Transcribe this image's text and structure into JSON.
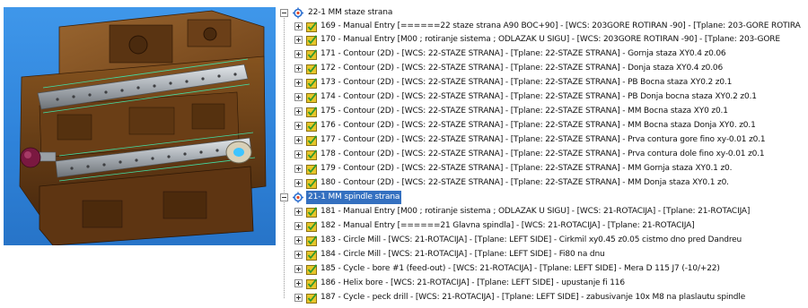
{
  "tree": {
    "groups": [
      {
        "label": "22-1 MM staze strana",
        "selected": false,
        "items": [
          {
            "text": "169 - Manual Entry [======22 staze strana A90 BOC+90] - [WCS: 203GORE ROTIRAN -90] - [Tplane: 203-GORE ROTIRA"
          },
          {
            "text": "170 - Manual Entry [M00 ; rotiranje sistema ; ODLAZAK U SIGU] - [WCS: 203GORE ROTIRAN -90] - [Tplane: 203-GORE"
          },
          {
            "text": "171 - Contour (2D) - [WCS: 22-STAZE STRANA] - [Tplane: 22-STAZE STRANA] - Gornja staza XY0.4 z0.06"
          },
          {
            "text": "172 - Contour (2D) - [WCS: 22-STAZE STRANA] - [Tplane: 22-STAZE STRANA] - Donja staza XY0.4 z0.06"
          },
          {
            "text": "173 - Contour (2D) - [WCS: 22-STAZE STRANA] - [Tplane: 22-STAZE STRANA] - PB Bocna staza XY0.2 z0.1"
          },
          {
            "text": "174 - Contour (2D) - [WCS: 22-STAZE STRANA] - [Tplane: 22-STAZE STRANA] - PB Donja bocna staza XY0.2 z0.1"
          },
          {
            "text": "175 - Contour (2D) - [WCS: 22-STAZE STRANA] - [Tplane: 22-STAZE STRANA] - MM Bocna staza XY0 z0.1"
          },
          {
            "text": "176 - Contour (2D) - [WCS: 22-STAZE STRANA] - [Tplane: 22-STAZE STRANA] - MM Bocna staza Donja XY0. z0.1"
          },
          {
            "text": "177 - Contour (2D) - [WCS: 22-STAZE STRANA] - [Tplane: 22-STAZE STRANA] - Prva contura gore fino xy-0.01 z0.1"
          },
          {
            "text": "178 - Contour (2D) - [WCS: 22-STAZE STRANA] - [Tplane: 22-STAZE STRANA] - Prva contura dole fino xy-0.01 z0.1"
          },
          {
            "text": "179 - Contour (2D) - [WCS: 22-STAZE STRANA] - [Tplane: 22-STAZE STRANA] - MM Gornja staza XY0.1 z0."
          },
          {
            "text": "180 - Contour (2D) - [WCS: 22-STAZE STRANA] - [Tplane: 22-STAZE STRANA] - MM Donja staza XY0.1 z0."
          }
        ]
      },
      {
        "label": "21-1 MM spindle strana",
        "selected": true,
        "items": [
          {
            "text": "181 - Manual Entry [M00 ; rotiranje sistema ; ODLAZAK U SIGU] - [WCS: 21-ROTACIJA] - [Tplane: 21-ROTACIJA]"
          },
          {
            "text": "182 - Manual Entry [======21 Glavna spindla] - [WCS: 21-ROTACIJA] - [Tplane: 21-ROTACIJA]"
          },
          {
            "text": "183 - Circle Mill - [WCS: 21-ROTACIJA] - [Tplane: LEFT SIDE] - Cirkmil xy0.45 z0.05 cistmo dno pred Dandreu"
          },
          {
            "text": "184 - Circle Mill - [WCS: 21-ROTACIJA] - [Tplane: LEFT SIDE] - Fi80 na dnu"
          },
          {
            "text": "185 - Cycle - bore #1 (feed-out) - [WCS: 21-ROTACIJA] - [Tplane: LEFT SIDE] - Mera D 115 J7 (-10/+22)"
          },
          {
            "text": "186 - Helix bore - [WCS: 21-ROTACIJA] - [Tplane: LEFT SIDE] - upustanje fi 116"
          },
          {
            "text": "187 - Cycle - peck drill - [WCS: 21-ROTACIJA] - [Tplane: LEFT SIDE] - zabusivanje 10x M8 na plaslautu spindle"
          }
        ]
      }
    ]
  },
  "colors": {
    "viewport_bg": "#3f97ea",
    "part_body": "#7a4a1e",
    "rail": "#a9b0b8",
    "selection": "#3470c0",
    "folder_icon": "#e8c62a",
    "check_icon": "#2e9a2e"
  },
  "icons": {
    "group": "operations-group-icon",
    "operation": "toolpath-check-icon",
    "folder": "folder-icon",
    "expander": "tree-expander-icon"
  }
}
